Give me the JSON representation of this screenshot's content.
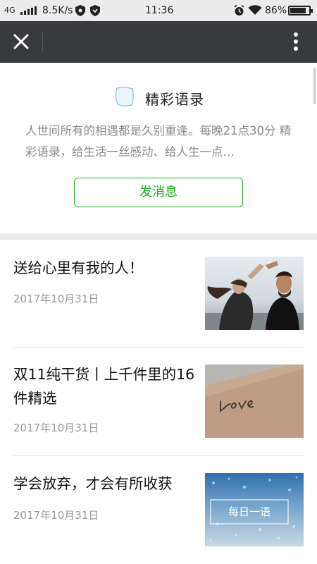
{
  "status_bar": {
    "network": "4G",
    "speed": "8.5K/s",
    "time": "11:36",
    "battery": "86%"
  },
  "nav": {
    "close_icon": "close-icon",
    "more_icon": "more-vertical-icon"
  },
  "profile": {
    "logo_text": "精彩语录",
    "name": "精彩语录",
    "description": "人世间所有的相遇都是久别重逢。每晚21点30分 精彩语录，给生活一丝感动、给人生一点…",
    "send_button": "发消息"
  },
  "articles": [
    {
      "title": "送给心里有我的人！",
      "date": "2017年10月31日"
    },
    {
      "title": "双11纯干货丨上千件里的16件精选",
      "date": "2017年10月31日"
    },
    {
      "title": "学会放弃，才会有所收获",
      "date": "2017年10月31日",
      "thumb_text": "每日一语"
    }
  ],
  "colors": {
    "accent": "#1aad19",
    "nav_bg": "#393a3e"
  }
}
